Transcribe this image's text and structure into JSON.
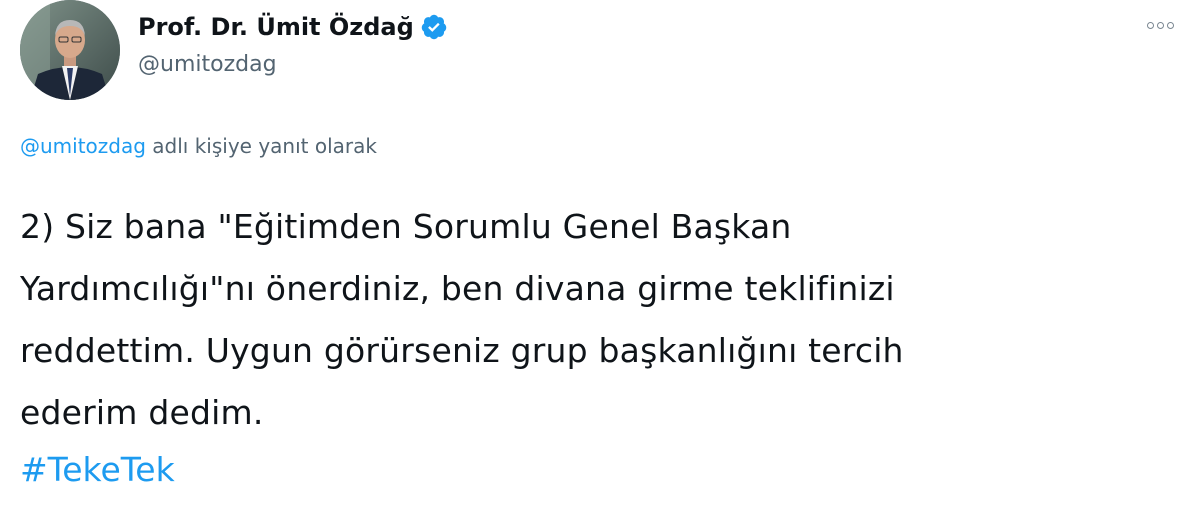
{
  "author": {
    "display_name": "Prof. Dr. Ümit Özdağ",
    "handle": "@umitozdag",
    "verified": true,
    "avatar_icon": "profile-photo"
  },
  "menu": {
    "more_icon": "more-horizontal-icon"
  },
  "reply_context": {
    "mention": "@umitozdag",
    "suffix": " adlı kişiye yanıt olarak"
  },
  "tweet": {
    "lines": [
      "2) Siz bana \"Eğitimden Sorumlu Genel Başkan",
      "Yardımcılığı\"nı önerdiniz, ben divana girme teklifinizi",
      "reddettim. Uygun görürseniz grup başkanlığını tercih",
      "ederim dedim."
    ],
    "hashtag": "#TekeTek"
  },
  "colors": {
    "link": "#1d9bf0",
    "text": "#0f1419",
    "secondary": "#536471",
    "verified_badge": "#1d9bf0"
  }
}
